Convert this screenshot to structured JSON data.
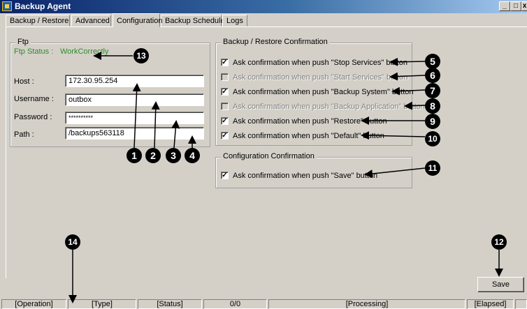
{
  "window": {
    "title": "Backup Agent",
    "minimize_glyph": "_",
    "maximize_glyph": "□",
    "close_glyph": "x"
  },
  "tabs": [
    "Backup / Restore",
    "Advanced",
    "Configuration",
    "Backup Schedule",
    "Logs"
  ],
  "active_tab": "Configuration",
  "ftp": {
    "legend": "Ftp",
    "status_label": "Ftp Status :",
    "status_value": "WorkCorrectly",
    "status_color": "#2e8b2e",
    "host_label": "Host :",
    "host_value": "172.30.95.254",
    "username_label": "Username :",
    "username_value": "outbox",
    "password_label": "Password :",
    "password_value": "**********",
    "path_label": "Path :",
    "path_value": "/backups563118"
  },
  "backup_restore_confirmation": {
    "legend": "Backup / Restore Confirmation",
    "options": [
      {
        "label": "Ask confirmation when push \"Stop Services\" button",
        "checked": true,
        "enabled": true
      },
      {
        "label": "Ask confirmation when push \"Start Services\" button",
        "checked": false,
        "enabled": false
      },
      {
        "label": "Ask confirmation when push \"Backup System\" button",
        "checked": true,
        "enabled": true
      },
      {
        "label": "Ask confirmation when push \"Backup Application\" button",
        "checked": false,
        "enabled": false
      },
      {
        "label": "Ask confirmation when push \"Restore\" button",
        "checked": true,
        "enabled": true
      },
      {
        "label": "Ask confirmation when push \"Default\" button",
        "checked": true,
        "enabled": true
      }
    ]
  },
  "configuration_confirmation": {
    "legend": "Configuration Confirmation",
    "options": [
      {
        "label": "Ask confirmation when push \"Save\" button",
        "checked": true,
        "enabled": true
      }
    ]
  },
  "save_label": "Save",
  "statusbar": [
    "[Operation]",
    "[Type]",
    "[Status]",
    "0/0",
    "[Processing]",
    "[Elapsed]",
    ""
  ],
  "annotations": [
    "1",
    "2",
    "3",
    "4",
    "5",
    "6",
    "7",
    "8",
    "9",
    "10",
    "11",
    "12",
    "13",
    "14"
  ],
  "check_glyph": "✓"
}
